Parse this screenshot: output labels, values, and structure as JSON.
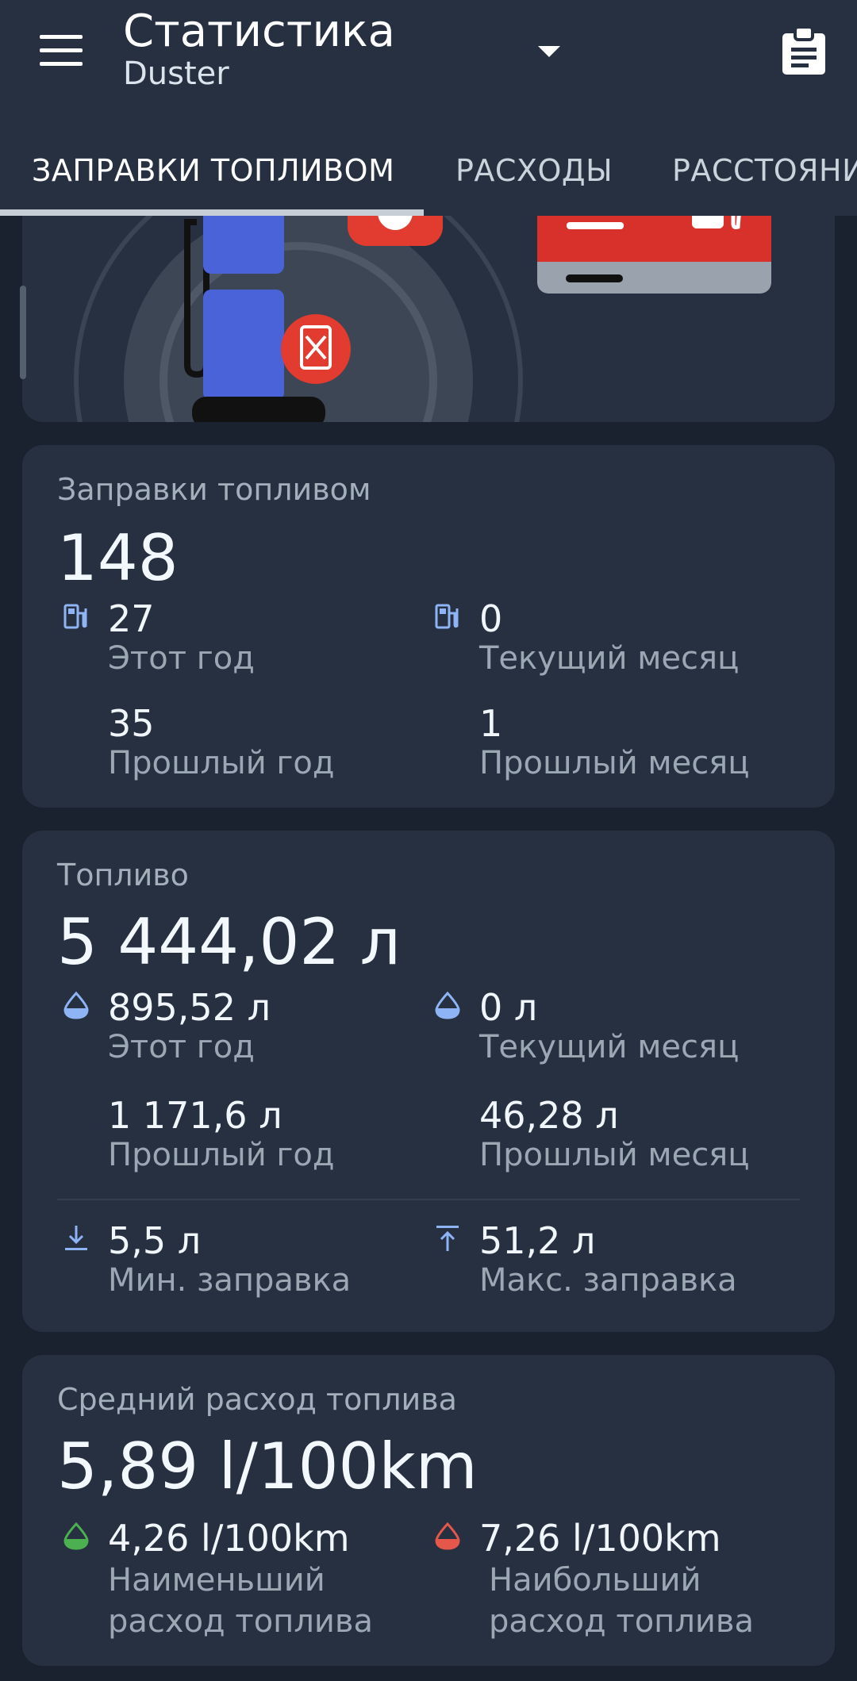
{
  "header": {
    "title": "Статистика",
    "subtitle": "Duster"
  },
  "tabs": [
    {
      "label": "ЗАПРАВКИ ТОПЛИВОМ",
      "active": true
    },
    {
      "label": "РАСХОДЫ",
      "active": false
    },
    {
      "label": "РАССТОЯНИ",
      "active": false
    }
  ],
  "refuels": {
    "label": "Заправки топливом",
    "total": "148",
    "this_year": {
      "value": "27",
      "label": "Этот год"
    },
    "current_month": {
      "value": "0",
      "label": "Текущий месяц"
    },
    "last_year": {
      "value": "35",
      "label": "Прошлый год"
    },
    "last_month": {
      "value": "1",
      "label": "Прошлый месяц"
    }
  },
  "fuel": {
    "label": "Топливо",
    "total": "5 444,02 л",
    "this_year": {
      "value": "895,52 л",
      "label": "Этот год"
    },
    "current_month": {
      "value": "0 л",
      "label": "Текущий месяц"
    },
    "last_year": {
      "value": "1 171,6 л",
      "label": "Прошлый год"
    },
    "last_month": {
      "value": "46,28 л",
      "label": "Прошлый месяц"
    },
    "min_refuel": {
      "value": "5,5 л",
      "label": "Мин. заправка"
    },
    "max_refuel": {
      "value": "51,2 л",
      "label": "Макс. заправка"
    }
  },
  "consumption": {
    "label": "Средний расход топлива",
    "average": "5,89 l/100km",
    "lowest": {
      "value": "4,26 l/100km",
      "label": "Наименьший расход топлива"
    },
    "highest": {
      "value": "7,26 l/100km",
      "label": "Наибольший расход топлива"
    }
  },
  "colors": {
    "appbar": "#263040",
    "background": "#1a2230",
    "card": "#263040",
    "icon_blue": "#8fb4f5",
    "green": "#4caf50",
    "red": "#e5574b"
  }
}
